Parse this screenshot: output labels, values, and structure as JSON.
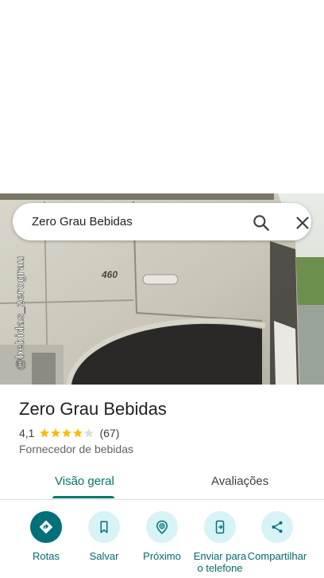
{
  "search": {
    "query": "Zero Grau Bebidas"
  },
  "photo": {
    "watermark": "@bebidas_zerograu",
    "badge": "460"
  },
  "place": {
    "title": "Zero Grau Bebidas",
    "rating": "4,1",
    "review_count": "(67)",
    "stars_filled": 4,
    "category": "Fornecedor de bebidas"
  },
  "tabs": [
    {
      "label": "Visão geral",
      "active": true
    },
    {
      "label": "Avaliações",
      "active": false
    }
  ],
  "actions": [
    {
      "label": "Rotas",
      "icon": "directions-icon"
    },
    {
      "label": "Salvar",
      "icon": "bookmark-icon"
    },
    {
      "label": "Próximo",
      "icon": "nearby-icon"
    },
    {
      "label": "Enviar para o telefone",
      "icon": "send-to-phone-icon"
    },
    {
      "label": "Compartilhar",
      "icon": "share-icon"
    }
  ],
  "colors": {
    "accent": "#00796b",
    "star": "#fbbc04",
    "chip": "#d7f3f5"
  }
}
